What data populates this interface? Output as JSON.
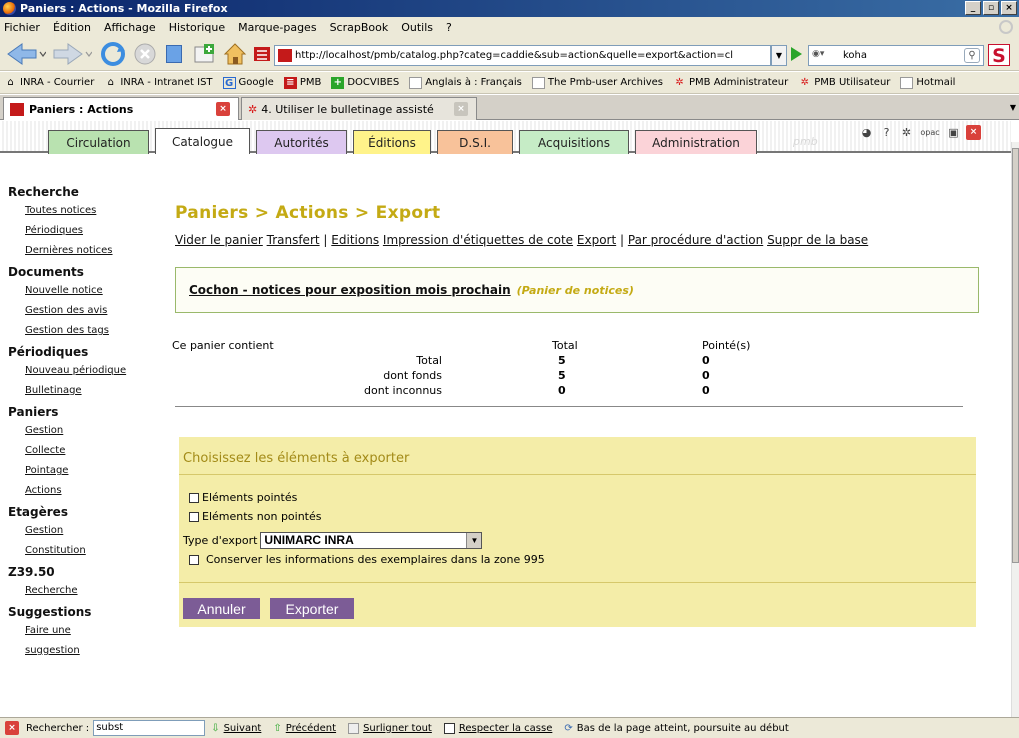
{
  "window": {
    "title": "Paniers : Actions - Mozilla Firefox"
  },
  "menu": [
    "Fichier",
    "Édition",
    "Affichage",
    "Historique",
    "Marque-pages",
    "ScrapBook",
    "Outils",
    "?"
  ],
  "nav": {
    "url": "http://localhost/pmb/catalog.php?categ=caddie&sub=action&quelle=export&action=cl",
    "search_value": "koha"
  },
  "bookmarks": [
    "INRA - Courrier",
    "INRA - Intranet IST",
    "Google",
    "PMB",
    "DOCVIBES",
    "Anglais à : Français",
    "The Pmb-user Archives",
    "PMB Administrateur",
    "PMB Utilisateur",
    "Hotmail"
  ],
  "tabs": [
    {
      "label": "Paniers : Actions"
    },
    {
      "label": "4. Utiliser le bulletinage assisté"
    }
  ],
  "modules": [
    "Circulation",
    "Catalogue",
    "Autorités",
    "Éditions",
    "D.S.I.",
    "Acquisitions",
    "Administration"
  ],
  "module_colors": [
    "#b9e2b0",
    "#ffffff",
    "#ddc8f0",
    "#fff38a",
    "#f8c29a",
    "#c6ecc6",
    "#fbd3d8"
  ],
  "logo": "pmb",
  "sidebar": [
    {
      "title": "Recherche",
      "items": [
        "Toutes notices",
        "Périodiques",
        "Dernières notices"
      ]
    },
    {
      "title": "Documents",
      "items": [
        "Nouvelle notice",
        "Gestion des avis",
        "Gestion des tags"
      ]
    },
    {
      "title": "Périodiques",
      "items": [
        "Nouveau périodique",
        "Bulletinage"
      ]
    },
    {
      "title": "Paniers",
      "items": [
        "Gestion",
        "Collecte",
        "Pointage",
        "Actions"
      ]
    },
    {
      "title": "Etagères",
      "items": [
        "Gestion",
        "Constitution"
      ]
    },
    {
      "title": "Z39.50",
      "items": [
        "Recherche"
      ]
    },
    {
      "title": "Suggestions",
      "items": [
        "Faire une",
        "suggestion"
      ]
    }
  ],
  "main": {
    "title": "Paniers > Actions > Export",
    "actions": [
      "Vider le panier",
      "Transfert",
      "|",
      "Editions",
      "Impression d'étiquettes de cote",
      "Export",
      "|",
      "Par procédure d'action",
      "Suppr de la base"
    ],
    "cart_name": "Cochon - notices pour exposition mois prochain",
    "cart_type": "(Panier de notices)",
    "stats_label": "Ce panier contient",
    "stats_head_total": "Total",
    "stats_head_pointed": "Pointé(s)",
    "stats": [
      {
        "label": "Total",
        "total": "5",
        "pointed": "0"
      },
      {
        "label": "dont fonds",
        "total": "5",
        "pointed": "0"
      },
      {
        "label": "dont inconnus",
        "total": "0",
        "pointed": "0"
      }
    ],
    "export": {
      "title": "Choisissez les éléments à exporter",
      "opt_pointed": "Eléments pointés",
      "opt_not_pointed": "Eléments non pointés",
      "type_label": "Type d'export",
      "type_value": "UNIMARC INRA",
      "keep_995": "Conserver les informations des exemplaires dans la zone 995",
      "cancel": "Annuler",
      "submit": "Exporter"
    }
  },
  "findbar": {
    "label": "Rechercher :",
    "value": "subst",
    "next": "Suivant",
    "prev": "Précédent",
    "highlight": "Surligner tout",
    "match_case": "Respecter la casse",
    "status": "Bas de la page atteint, poursuite au début"
  }
}
